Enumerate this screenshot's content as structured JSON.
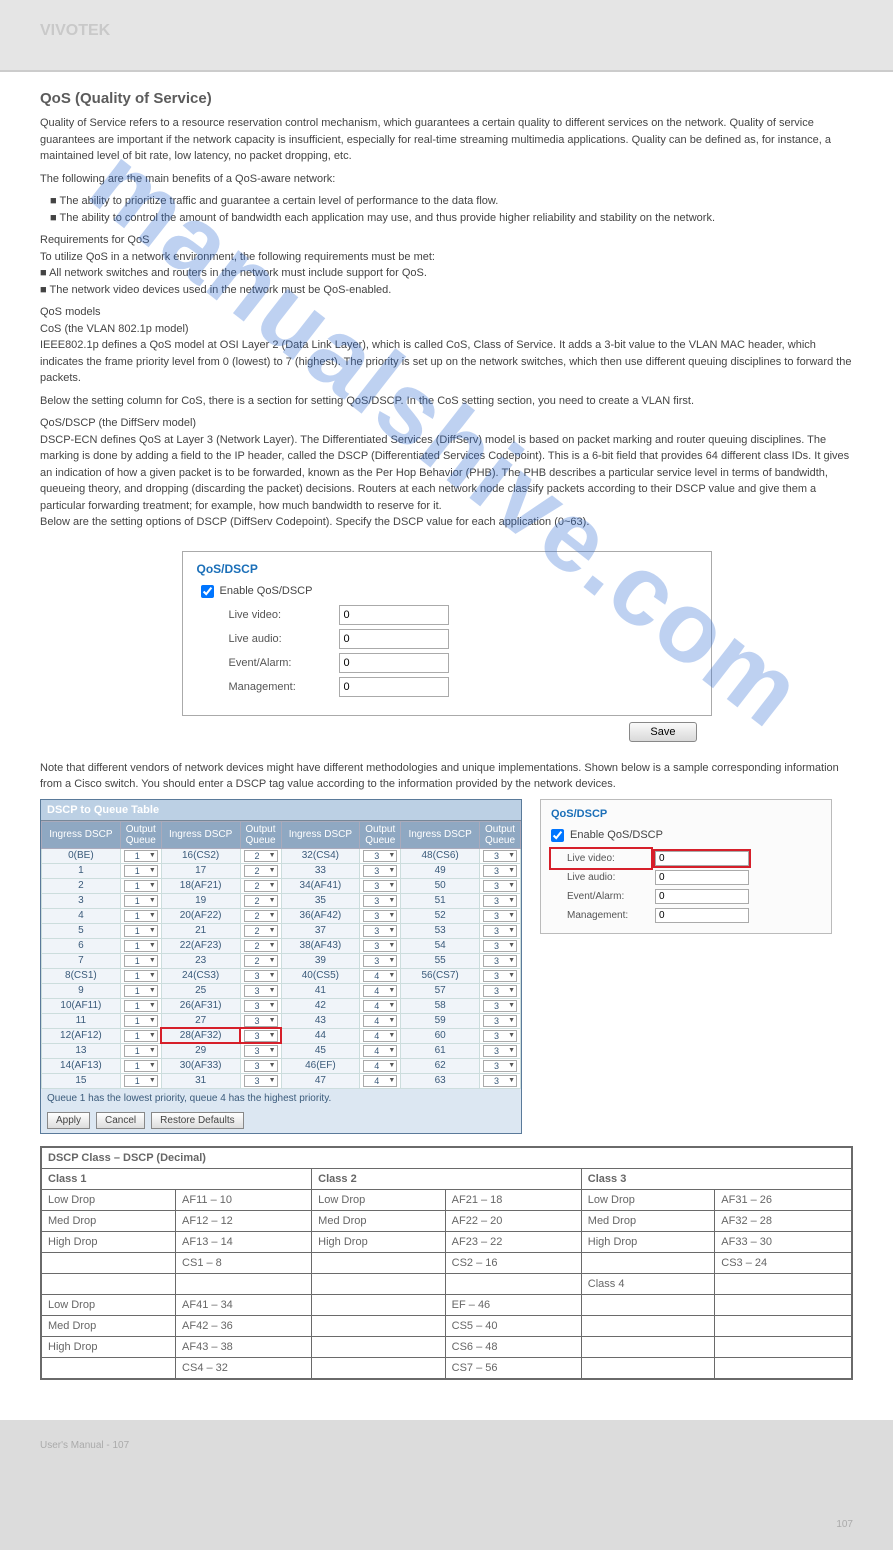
{
  "watermark": "manualshive.com",
  "header": {
    "brand": "VIVOTEK"
  },
  "section1": {
    "title": "QoS (Quality of Service)",
    "p1": "Quality of Service refers to a resource reservation control mechanism, which guarantees a certain quality to different services on the network. Quality of service guarantees are important if the network capacity is insufficient, especially for real-time streaming multimedia applications. Quality can be defined as, for instance, a maintained level of bit rate, low latency, no packet dropping, etc.",
    "p2": "The following are the main benefits of a QoS-aware network:",
    "p3a": "■ The ability to prioritize traffic and guarantee a certain level of performance to the data flow.\n■ The ability to control the amount of bandwidth each application may use, and thus provide higher reliability and stability on the network.",
    "p3b": "",
    "p3c": "",
    "p4": "Requirements for QoS\nTo utilize QoS in a network environment, the following requirements must be met:\n■ All network switches and routers in the network must include support for QoS.\n■ The network video devices used in the network must be QoS-enabled.",
    "p5": "QoS models\nCoS (the VLAN 802.1p model)\nIEEE802.1p defines a QoS model at OSI Layer 2 (Data Link Layer), which is called CoS, Class of Service. It adds a 3-bit value to the VLAN MAC header, which indicates the frame priority level from 0 (lowest) to 7 (highest). The priority is set up on the network switches, which then use different queuing disciplines to forward the packets.",
    "p6": "Below the setting column for CoS, there is a section for setting QoS/DSCP. In the CoS setting section, you need to create a VLAN first.",
    "p7": "QoS/DSCP (the DiffServ model)\nDSCP-ECN defines QoS at Layer 3 (Network Layer). The Differentiated Services (DiffServ) model is based on packet marking and router queuing disciplines. The marking is done by adding a field to the IP header, called the DSCP (Differentiated Services Codepoint). This is a 6-bit field that provides 64 different class IDs. It gives an indication of how a given packet is to be forwarded, known as the Per Hop Behavior (PHB). The PHB describes a particular service level in terms of bandwidth, queueing theory, and dropping (discarding the packet) decisions. Routers at each network node classify packets according to their DSCP value and give them a particular forwarding treatment; for example, how much bandwidth to reserve for it.\nBelow are the setting options of DSCP (DiffServ Codepoint). Specify the DSCP value for each application (0~63).",
    "figcap": ""
  },
  "qos": {
    "legend": "QoS/DSCP",
    "enable": "Enable QoS/DSCP",
    "save": "Save",
    "fields": [
      {
        "label": "Live video:",
        "value": "0"
      },
      {
        "label": "Live audio:",
        "value": "0"
      },
      {
        "label": "Event/Alarm:",
        "value": "0"
      },
      {
        "label": "Management:",
        "value": "0"
      }
    ]
  },
  "section2": {
    "p1": "Note that different vendors of network devices might have different methodologies and unique implementations. Shown below is a sample corresponding information from a Cisco switch. You should enter a DSCP tag value according to the information provided by the network devices."
  },
  "switch": {
    "title": "DSCP to Queue Table",
    "headers": [
      "Ingress DSCP",
      "Output Queue",
      "Ingress DSCP",
      "Output Queue",
      "Ingress DSCP",
      "Output Queue",
      "Ingress DSCP",
      "Output Queue"
    ],
    "note": "Queue 1 has the lowest priority, queue 4 has the highest priority.",
    "btns": [
      "Apply",
      "Cancel",
      "Restore Defaults"
    ],
    "highlight": {
      "col": 1,
      "row": 12
    },
    "rows": [
      [
        "0(BE)",
        "1",
        "16(CS2)",
        "2",
        "32(CS4)",
        "3",
        "48(CS6)",
        "3"
      ],
      [
        "1",
        "1",
        "17",
        "2",
        "33",
        "3",
        "49",
        "3"
      ],
      [
        "2",
        "1",
        "18(AF21)",
        "2",
        "34(AF41)",
        "3",
        "50",
        "3"
      ],
      [
        "3",
        "1",
        "19",
        "2",
        "35",
        "3",
        "51",
        "3"
      ],
      [
        "4",
        "1",
        "20(AF22)",
        "2",
        "36(AF42)",
        "3",
        "52",
        "3"
      ],
      [
        "5",
        "1",
        "21",
        "2",
        "37",
        "3",
        "53",
        "3"
      ],
      [
        "6",
        "1",
        "22(AF23)",
        "2",
        "38(AF43)",
        "3",
        "54",
        "3"
      ],
      [
        "7",
        "1",
        "23",
        "2",
        "39",
        "3",
        "55",
        "3"
      ],
      [
        "8(CS1)",
        "1",
        "24(CS3)",
        "3",
        "40(CS5)",
        "4",
        "56(CS7)",
        "3"
      ],
      [
        "9",
        "1",
        "25",
        "3",
        "41",
        "4",
        "57",
        "3"
      ],
      [
        "10(AF11)",
        "1",
        "26(AF31)",
        "3",
        "42",
        "4",
        "58",
        "3"
      ],
      [
        "11",
        "1",
        "27",
        "3",
        "43",
        "4",
        "59",
        "3"
      ],
      [
        "12(AF12)",
        "1",
        "28(AF32)",
        "3",
        "44",
        "4",
        "60",
        "3"
      ],
      [
        "13",
        "1",
        "29",
        "3",
        "45",
        "4",
        "61",
        "3"
      ],
      [
        "14(AF13)",
        "1",
        "30(AF33)",
        "3",
        "46(EF)",
        "4",
        "62",
        "3"
      ],
      [
        "15",
        "1",
        "31",
        "3",
        "47",
        "4",
        "63",
        "3"
      ]
    ]
  },
  "dscp": {
    "title": "DSCP Class – DSCP (Decimal)",
    "h1": "Class 1",
    "h2": "Class 2",
    "h3": "Class 3",
    "rows": [
      [
        "Low Drop",
        "AF11 – 10",
        "Low Drop",
        "AF21 – 18",
        "Low Drop",
        "AF31 – 26"
      ],
      [
        "Med Drop",
        "AF12 – 12",
        "Med Drop",
        "AF22 – 20",
        "Med Drop",
        "AF32 – 28"
      ],
      [
        "High Drop",
        "AF13 – 14",
        "High Drop",
        "AF23 – 22",
        "High Drop",
        "AF33 – 30"
      ],
      [
        "",
        "CS1 – 8",
        "",
        "CS2 – 16",
        "",
        "CS3 – 24"
      ],
      [
        "",
        "",
        "",
        "",
        "Class 4",
        ""
      ],
      [
        "Low Drop",
        "AF41 – 34",
        "",
        "EF – 46",
        "",
        ""
      ],
      [
        "Med Drop",
        "AF42 – 36",
        "",
        "CS5 – 40",
        "",
        ""
      ],
      [
        "High Drop",
        "AF43 – 38",
        "",
        "CS6 – 48",
        "",
        ""
      ],
      [
        "",
        "CS4 – 32",
        "",
        "CS7 – 56",
        "",
        ""
      ]
    ]
  },
  "footer": {
    "text": "User's Manual - 107",
    "page": "107"
  }
}
